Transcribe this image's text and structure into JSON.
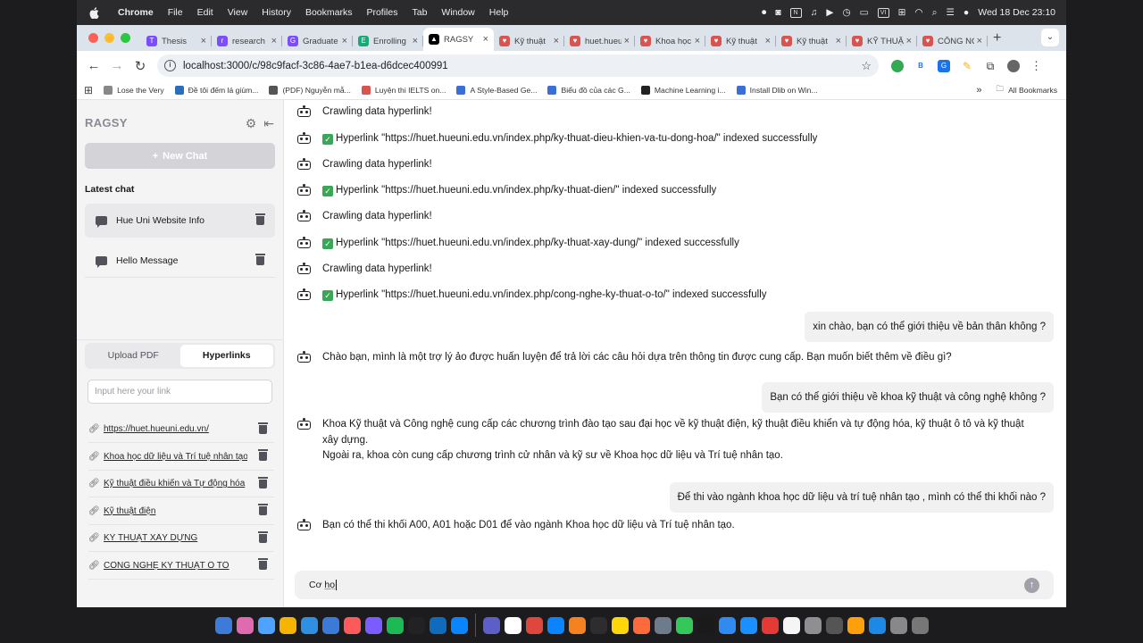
{
  "menubar": {
    "app": "Chrome",
    "items": [
      "File",
      "Edit",
      "View",
      "History",
      "Bookmarks",
      "Profiles",
      "Tab",
      "Window",
      "Help"
    ],
    "vi_badge": "VI",
    "clock": "Wed 18 Dec  23:10"
  },
  "tabs": [
    {
      "title": "Thesis",
      "color": "#7c4dff",
      "glyph": "T"
    },
    {
      "title": "research",
      "color": "#7c4dff",
      "glyph": "r"
    },
    {
      "title": "Graduate",
      "color": "#7c4dff",
      "glyph": "G"
    },
    {
      "title": "Enrolling",
      "color": "#19a974",
      "glyph": "E"
    },
    {
      "title": "RAGSY",
      "color": "#000000",
      "glyph": "▲",
      "active": true
    },
    {
      "title": "Kỹ thuật",
      "color": "#d9534f",
      "glyph": "♥"
    },
    {
      "title": "huet.hueuni",
      "color": "#d9534f",
      "glyph": "♥"
    },
    {
      "title": "Khoa học",
      "color": "#d9534f",
      "glyph": "♥"
    },
    {
      "title": "Kỹ thuật",
      "color": "#d9534f",
      "glyph": "♥"
    },
    {
      "title": "Kỹ thuật",
      "color": "#d9534f",
      "glyph": "♥"
    },
    {
      "title": "KỸ THUẬT",
      "color": "#d9534f",
      "glyph": "♥"
    },
    {
      "title": "CÔNG NGHỆ",
      "color": "#d9534f",
      "glyph": "♥"
    }
  ],
  "address": {
    "url": "localhost:3000/c/98c9facf-3c86-4ae7-b1ea-d6dcec400991"
  },
  "bookmarks": [
    {
      "label": "Lose the Very",
      "color": "#888"
    },
    {
      "label": "Đề tôi đếm lá giùm...",
      "color": "#2a6ebb"
    },
    {
      "label": "(PDF) Nguyễn mẫ...",
      "color": "#555"
    },
    {
      "label": "Luyện thi IELTS on...",
      "color": "#d9534f"
    },
    {
      "label": "A Style-Based Ge...",
      "color": "#3b6fd8"
    },
    {
      "label": "Biểu đồ của các G...",
      "color": "#3b6fd8"
    },
    {
      "label": "Machine Learning i...",
      "color": "#222"
    },
    {
      "label": "Install Dlib on Win...",
      "color": "#3b6fd8"
    }
  ],
  "all_bookmarks": "All Bookmarks",
  "sidebar": {
    "brand": "RAGSY",
    "new_chat": "New Chat",
    "latest_heading": "Latest chat",
    "chats": [
      "Hue Uni Website Info",
      "Hello Message"
    ],
    "tab_upload": "Upload PDF",
    "tab_hyperlinks": "Hyperlinks",
    "link_placeholder": "Input here your link",
    "links": [
      "https://huet.hueuni.edu.vn/",
      "Khoa học dữ liệu và Trí tuệ nhân tạo",
      "Kỹ thuật điều khiển và Tự động hóa",
      "Kỹ thuật điện",
      "KỸ THUẬT XÂY DỰNG",
      "CÔNG NGHỆ KỸ THUẬT Ô TÔ"
    ]
  },
  "messages": [
    {
      "role": "bot",
      "text": "Crawling data hyperlink!"
    },
    {
      "role": "bot",
      "check": true,
      "text": "Hyperlink \"https://huet.hueuni.edu.vn/index.php/ky-thuat-dieu-khien-va-tu-dong-hoa/\" indexed successfully"
    },
    {
      "role": "bot",
      "text": "Crawling data hyperlink!"
    },
    {
      "role": "bot",
      "check": true,
      "text": "Hyperlink \"https://huet.hueuni.edu.vn/index.php/ky-thuat-dien/\" indexed successfully"
    },
    {
      "role": "bot",
      "text": "Crawling data hyperlink!"
    },
    {
      "role": "bot",
      "check": true,
      "text": "Hyperlink \"https://huet.hueuni.edu.vn/index.php/ky-thuat-xay-dung/\" indexed successfully"
    },
    {
      "role": "bot",
      "text": "Crawling data hyperlink!"
    },
    {
      "role": "bot",
      "check": true,
      "text": "Hyperlink \"https://huet.hueuni.edu.vn/index.php/cong-nghe-ky-thuat-o-to/\" indexed successfully"
    },
    {
      "role": "user",
      "text": "xin chào, bạn có thể giới thiệu về bản thân không ?"
    },
    {
      "role": "bot",
      "text": "Chào bạn, mình là một trợ lý ảo được huấn luyện để trả lời các câu hỏi dựa trên thông tin được cung cấp. Bạn muốn biết thêm về điều gì?"
    },
    {
      "role": "user",
      "text": "Bạn có thể giới thiệu về khoa kỹ thuật và công nghệ không ?"
    },
    {
      "role": "bot",
      "text": "Khoa Kỹ thuật và Công nghệ cung cấp các chương trình đào tạo sau đại học về kỹ thuật điện, kỹ thuật điều khiển và tự động hóa, kỹ thuật ô tô và kỹ thuật xây dựng.",
      "text2": "Ngoài ra, khoa còn cung cấp chương trình cử nhân và kỹ sư về Khoa học dữ liệu và Trí tuệ nhân tạo."
    },
    {
      "role": "user",
      "text": "Để thi vào ngành khoa học dữ liệu và trí tuệ nhân tạo , mình có thể thi khối nào ?"
    },
    {
      "role": "bot",
      "text": "Bạn có thể thi khối A00, A01 hoặc D01 để vào ngành Khoa học dữ liệu và Trí tuệ nhân tạo."
    }
  ],
  "composer": {
    "value_prefix": "Cơ ",
    "value_typed": "họ"
  },
  "dock": [
    "#3d7bd9",
    "#e06ab0",
    "#4da3ff",
    "#f4b400",
    "#2f8fe0",
    "#3c7ad8",
    "#ff5a5a",
    "#7b5cff",
    "#1db954",
    "#222",
    "#0f6cbd",
    "#0a84ff",
    "#5b5fc7",
    "#fff",
    "#e0473c",
    "#0a84ff",
    "#f58220",
    "#2d2d2d",
    "#ffd60a",
    "#ff6a3d",
    "#6e7b8b",
    "#34c759",
    "#1a1a1a",
    "#2f8bf0",
    "#1c8fff",
    "#e53935",
    "#f5f5f5",
    "#8e8e93",
    "#555",
    "#ff9f0a",
    "#1e88e5",
    "#888",
    "#777"
  ]
}
